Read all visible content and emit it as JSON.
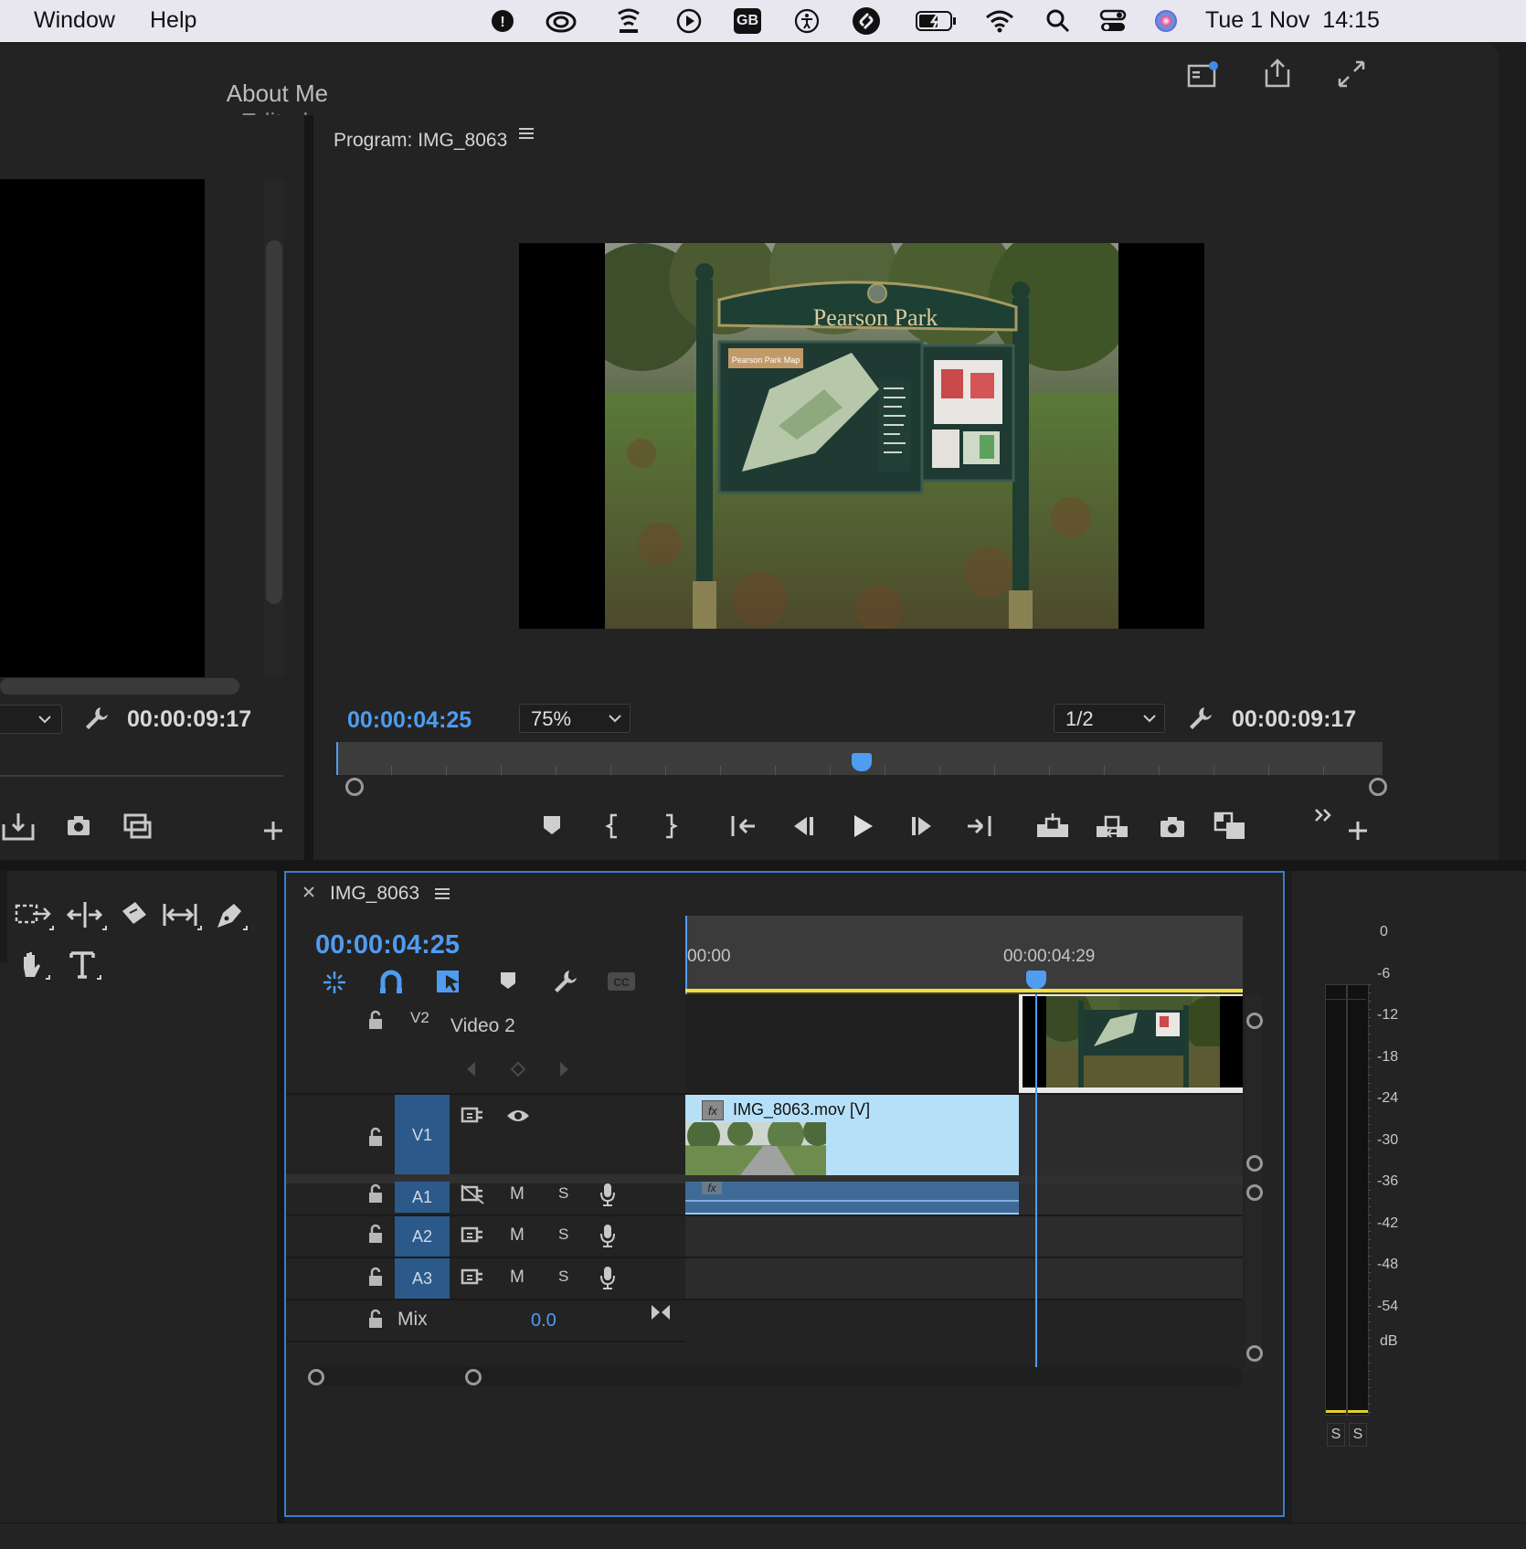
{
  "menubar": {
    "menus": [
      "Window",
      "Help"
    ],
    "status_icons": [
      "adobe-sync-icon",
      "creative-cloud-icon",
      "wifi-extender-icon",
      "media-play-icon",
      "keyboard-layout-icon",
      "accessibility-icon",
      "shazam-icon",
      "battery-icon",
      "wifi-icon",
      "search-icon",
      "control-center-icon",
      "siri-icon"
    ],
    "keyboard_layout": "GB",
    "clock": "Tue 1 Nov  14:15"
  },
  "app": {
    "project_title": "About Me",
    "project_status": "- Edited"
  },
  "source_monitor": {
    "timecode": "00:00:09:17"
  },
  "program_monitor": {
    "title": "Program: IMG_8063",
    "current_time": "00:00:04:25",
    "zoom": "75%",
    "resolution": "1/2",
    "duration": "00:00:09:17",
    "frame": {
      "sign_title": "Pearson Park",
      "map_label": "Pearson Park Map"
    }
  },
  "timeline": {
    "sequence_name": "IMG_8063",
    "current_time": "00:00:04:25",
    "ruler": [
      "00:00",
      "00:00:04:29"
    ],
    "tracks": {
      "v2": {
        "id": "V2",
        "name": "Video 2"
      },
      "v1": {
        "id": "V1"
      },
      "a1": {
        "id": "A1"
      },
      "a2": {
        "id": "A2"
      },
      "a3": {
        "id": "A3"
      },
      "mix": {
        "label": "Mix",
        "value": "0.0"
      }
    },
    "clip_v1": "IMG_8063.mov [V]",
    "mute_label": "M",
    "solo_label": "S"
  },
  "audio_meter": {
    "scale": [
      "0",
      "-6",
      "-12",
      "-18",
      "-24",
      "-30",
      "-36",
      "-42",
      "-48",
      "-54",
      "dB"
    ],
    "solo_labels": [
      "S",
      "S"
    ]
  },
  "colors": {
    "accent_blue": "#4f9cf0",
    "clip_video": "#b6e0f7",
    "clip_audio": "#3f6a96",
    "work_area": "#f1e03a"
  }
}
